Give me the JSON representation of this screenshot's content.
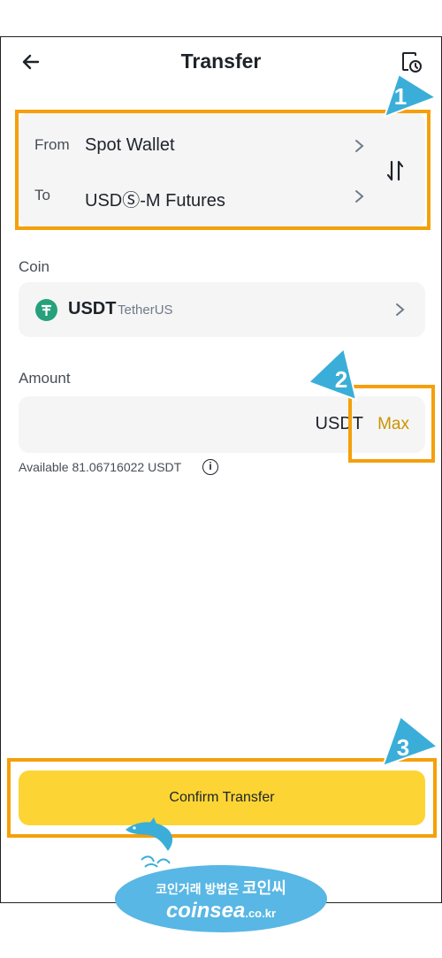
{
  "header": {
    "title": "Transfer"
  },
  "transfer": {
    "from_label": "From",
    "from_value": "Spot Wallet",
    "to_label": "To",
    "to_value": "USDⓈ-M Futures"
  },
  "coin": {
    "label": "Coin",
    "symbol": "USDT",
    "name": "TetherUS"
  },
  "amount": {
    "label": "Amount",
    "unit": "USDT",
    "max_label": "Max"
  },
  "available": "Available 81.06716022 USDT",
  "confirm_label": "Confirm Transfer",
  "callouts": [
    "1",
    "2",
    "3"
  ],
  "watermark": {
    "line1_small": "코인거래 방법은",
    "line1_big": "코인씨",
    "line2": "coinsea",
    "line2_suffix": ".co.kr"
  },
  "colors": {
    "accent": "#fcd535",
    "max": "#c99400",
    "highlight": "#f5a00a",
    "callout": "#3aaed8",
    "tether": "#26a17b"
  }
}
